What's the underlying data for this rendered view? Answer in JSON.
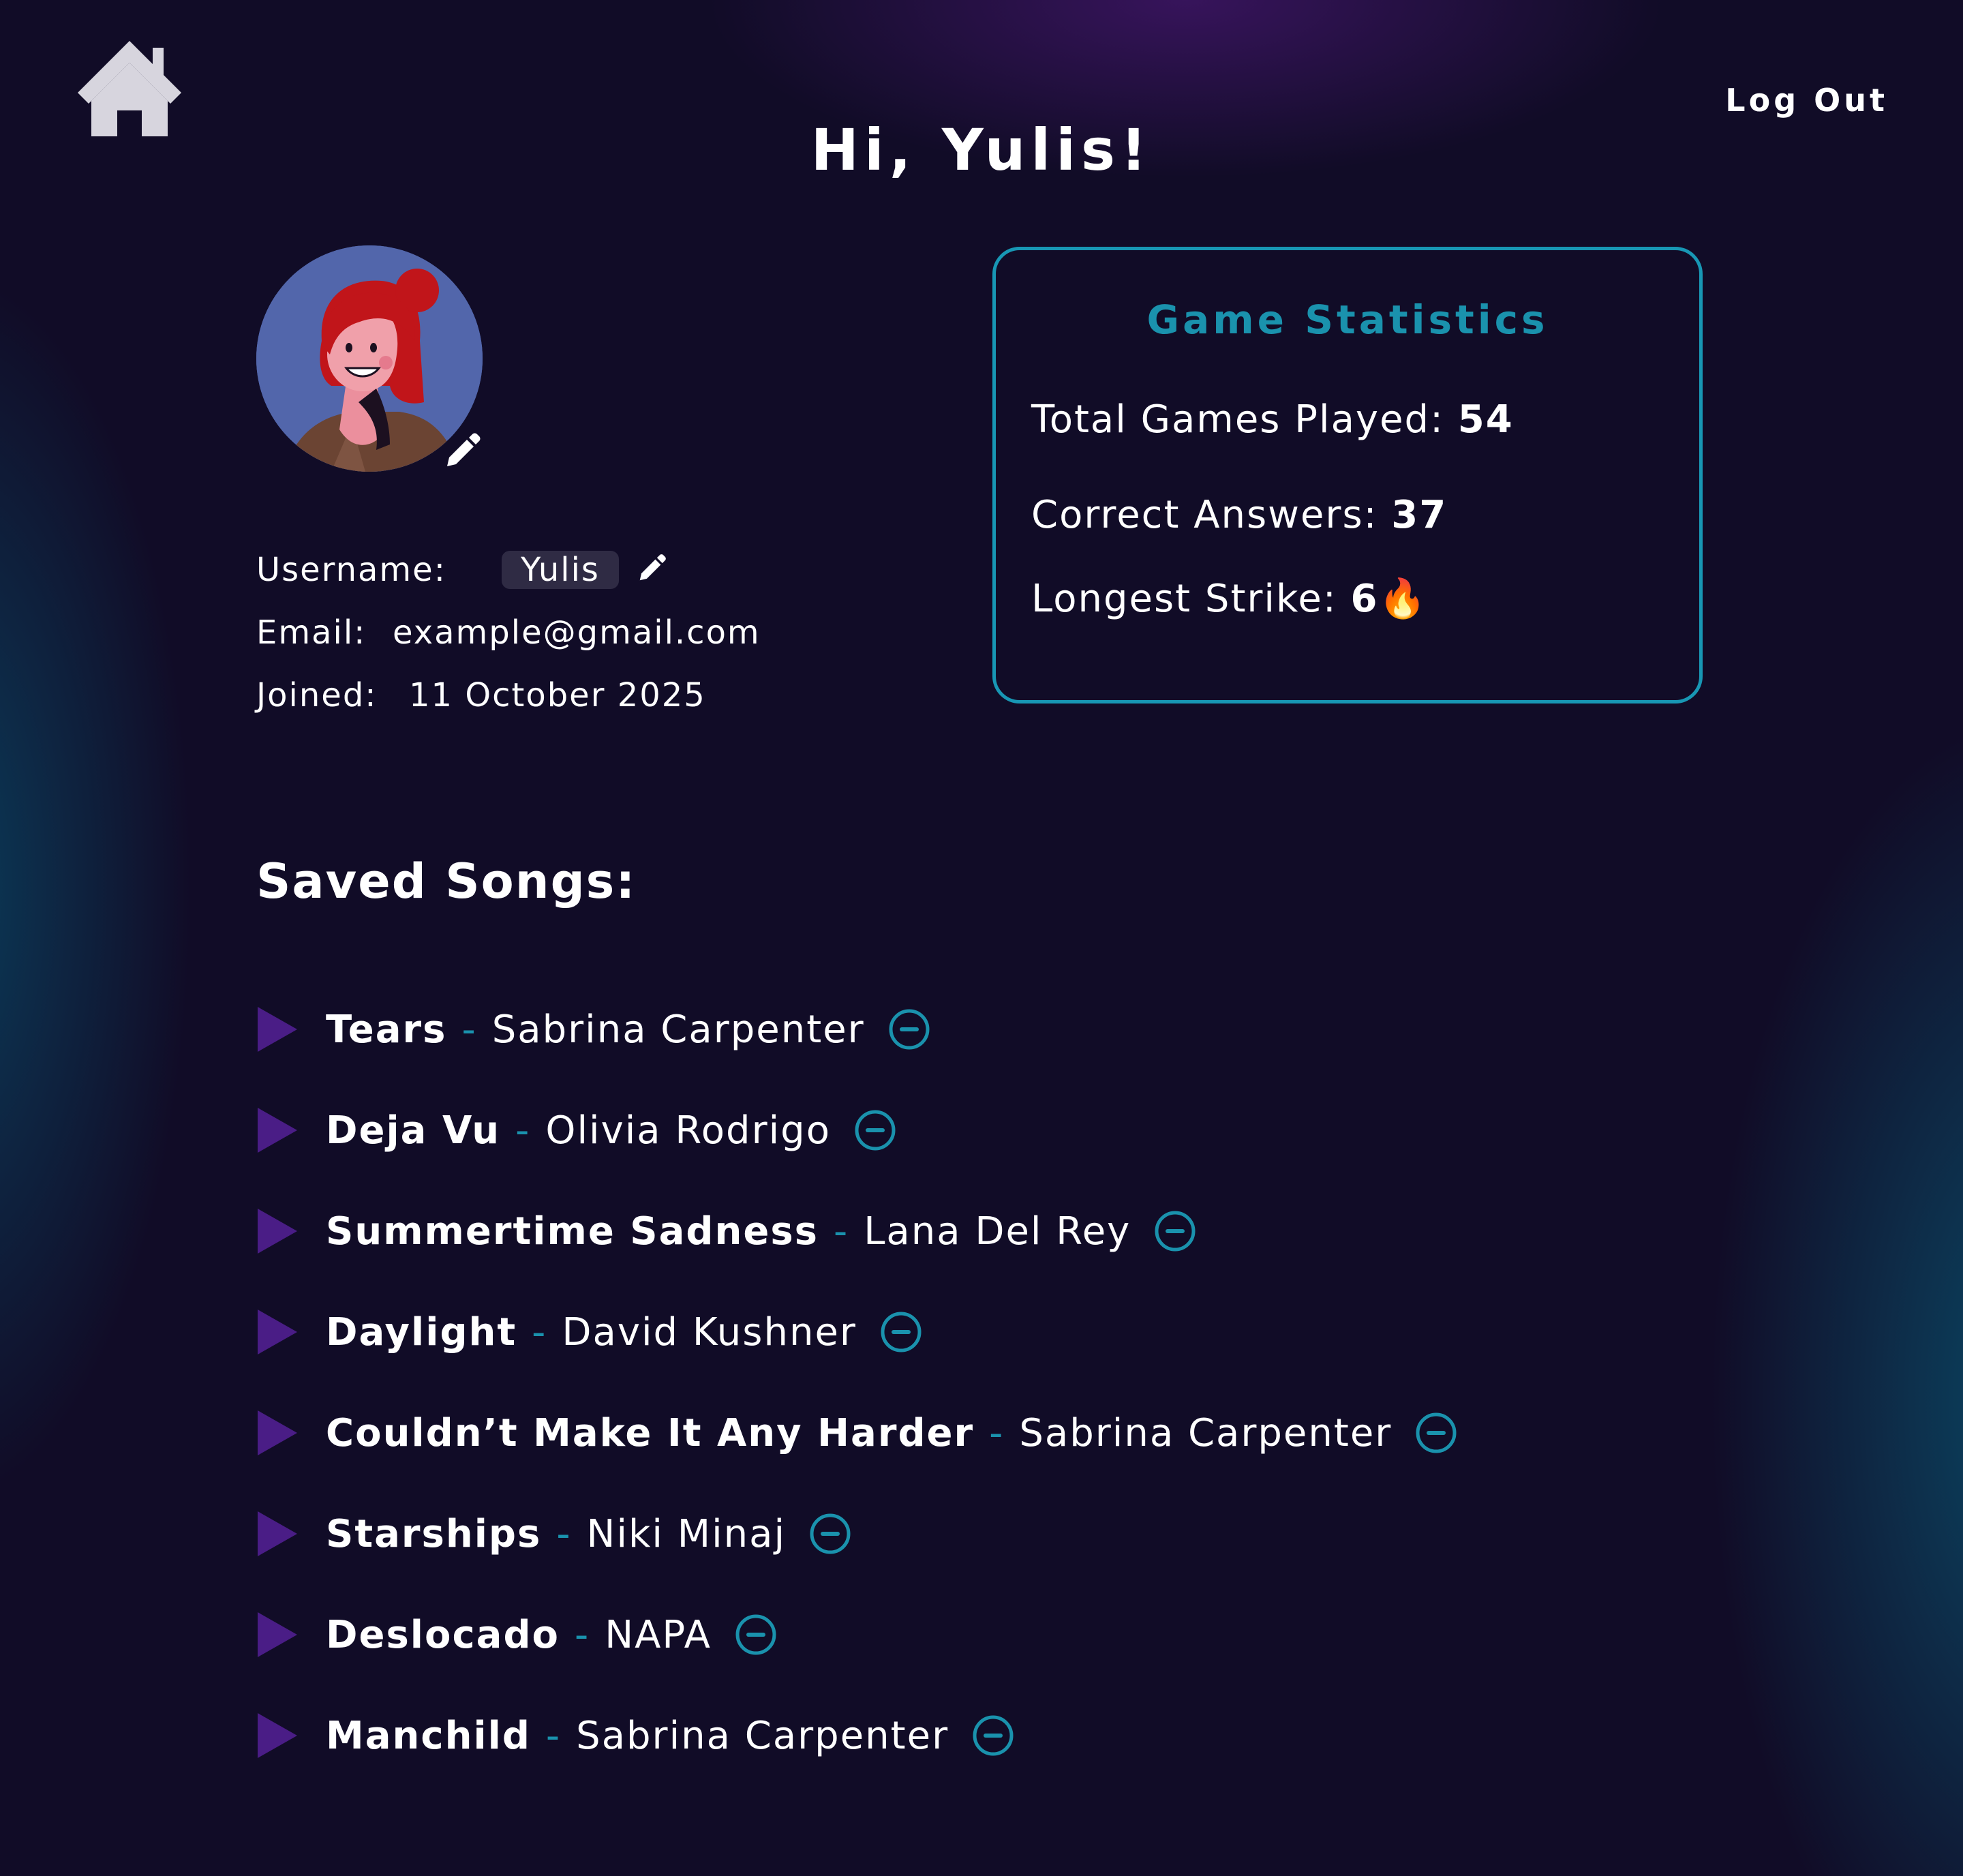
{
  "header": {
    "home_icon": "home-icon",
    "greeting": "Hi, Yulis!",
    "logout_label": "Log Out"
  },
  "profile": {
    "avatar_icon": "avatar",
    "edit_icon": "pencil-icon",
    "username_label": "Username:",
    "username_value": "Yulis",
    "email_label": "Email:",
    "email_value": "example@gmail.com",
    "joined_label": "Joined:",
    "joined_value": "11 October 2025"
  },
  "stats": {
    "title": "Game Statistics",
    "total_games_label": "Total Games Played: ",
    "total_games_value": "54",
    "correct_label": "Correct Answers: ",
    "correct_value": "37",
    "streak_label": "Longest Strike: ",
    "streak_value": "6",
    "streak_emoji": "🔥"
  },
  "saved_songs": {
    "heading": "Saved Songs:",
    "separator": "-",
    "items": [
      {
        "title": "Tears",
        "artist": "Sabrina Carpenter"
      },
      {
        "title": "Deja Vu",
        "artist": "Olivia Rodrigo"
      },
      {
        "title": "Summertime Sadness",
        "artist": "Lana Del Rey"
      },
      {
        "title": "Daylight",
        "artist": "David Kushner"
      },
      {
        "title": "Couldn’t Make It Any Harder",
        "artist": "Sabrina Carpenter"
      },
      {
        "title": "Starships",
        "artist": "Niki Minaj"
      },
      {
        "title": "Deslocado",
        "artist": "NAPA"
      },
      {
        "title": "Manchild",
        "artist": "Sabrina Carpenter"
      }
    ]
  },
  "colors": {
    "background": "#110c27",
    "accent_teal": "#1a92ad",
    "play_purple": "#4a1d86",
    "chip_bg": "#2f2b44",
    "home_icon": "#d7d5de"
  }
}
